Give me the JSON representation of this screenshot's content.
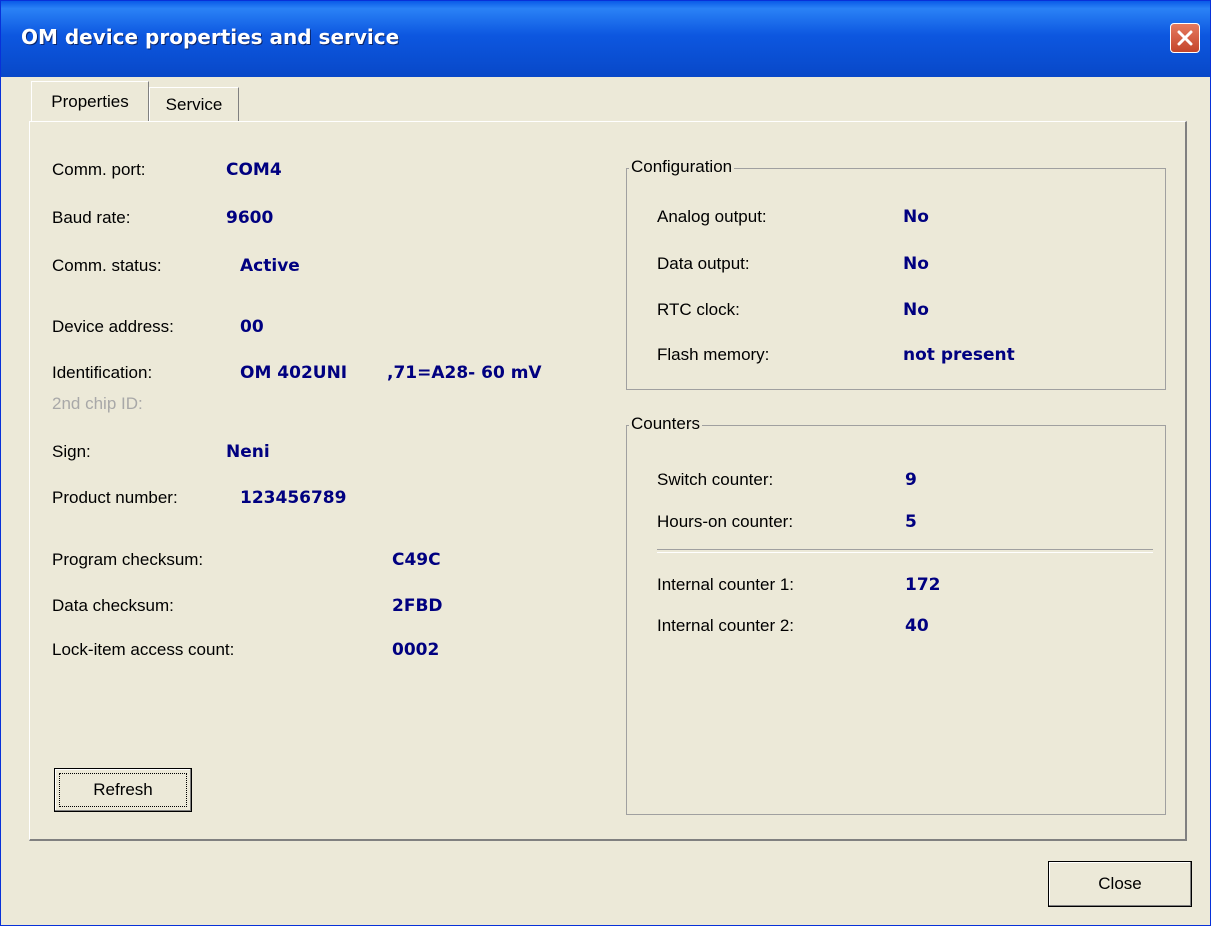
{
  "window": {
    "title": "OM device properties and service"
  },
  "tabs": [
    {
      "label": "Properties",
      "active": true
    },
    {
      "label": "Service",
      "active": false
    }
  ],
  "properties": {
    "comm_port": {
      "label": "Comm. port:",
      "value": "COM4"
    },
    "baud_rate": {
      "label": "Baud rate:",
      "value": "9600"
    },
    "comm_status": {
      "label": "Comm. status:",
      "value": "Active"
    },
    "device_address": {
      "label": "Device address:",
      "value": "00"
    },
    "identification": {
      "label": "Identification:",
      "value": "OM 402UNI",
      "extra": ",71=A28- 60 mV"
    },
    "second_chip": {
      "label": "2nd chip ID:"
    },
    "sign": {
      "label": "Sign:",
      "value": "Neni"
    },
    "product_number": {
      "label": "Product number:",
      "value": "123456789"
    },
    "program_checksum": {
      "label": "Program checksum:",
      "value": "C49C"
    },
    "data_checksum": {
      "label": "Data checksum:",
      "value": "2FBD"
    },
    "lock_item": {
      "label": "Lock-item access count:",
      "value": "0002"
    }
  },
  "configuration": {
    "title": "Configuration",
    "analog_output": {
      "label": "Analog output:",
      "value": "No"
    },
    "data_output": {
      "label": "Data output:",
      "value": "No"
    },
    "rtc_clock": {
      "label": "RTC clock:",
      "value": "No"
    },
    "flash_memory": {
      "label": "Flash memory:",
      "value": "not present"
    }
  },
  "counters": {
    "title": "Counters",
    "switch_counter": {
      "label": "Switch counter:",
      "value": "9"
    },
    "hours_on": {
      "label": "Hours-on counter:",
      "value": "5"
    },
    "internal_1": {
      "label": "Internal counter 1:",
      "value": "172"
    },
    "internal_2": {
      "label": "Internal counter 2:",
      "value": "40"
    }
  },
  "buttons": {
    "refresh": "Refresh",
    "close": "Close"
  },
  "colors": {
    "value_text": "#000080",
    "titlebar": "#0a5ae8",
    "face": "#ece9d8"
  }
}
